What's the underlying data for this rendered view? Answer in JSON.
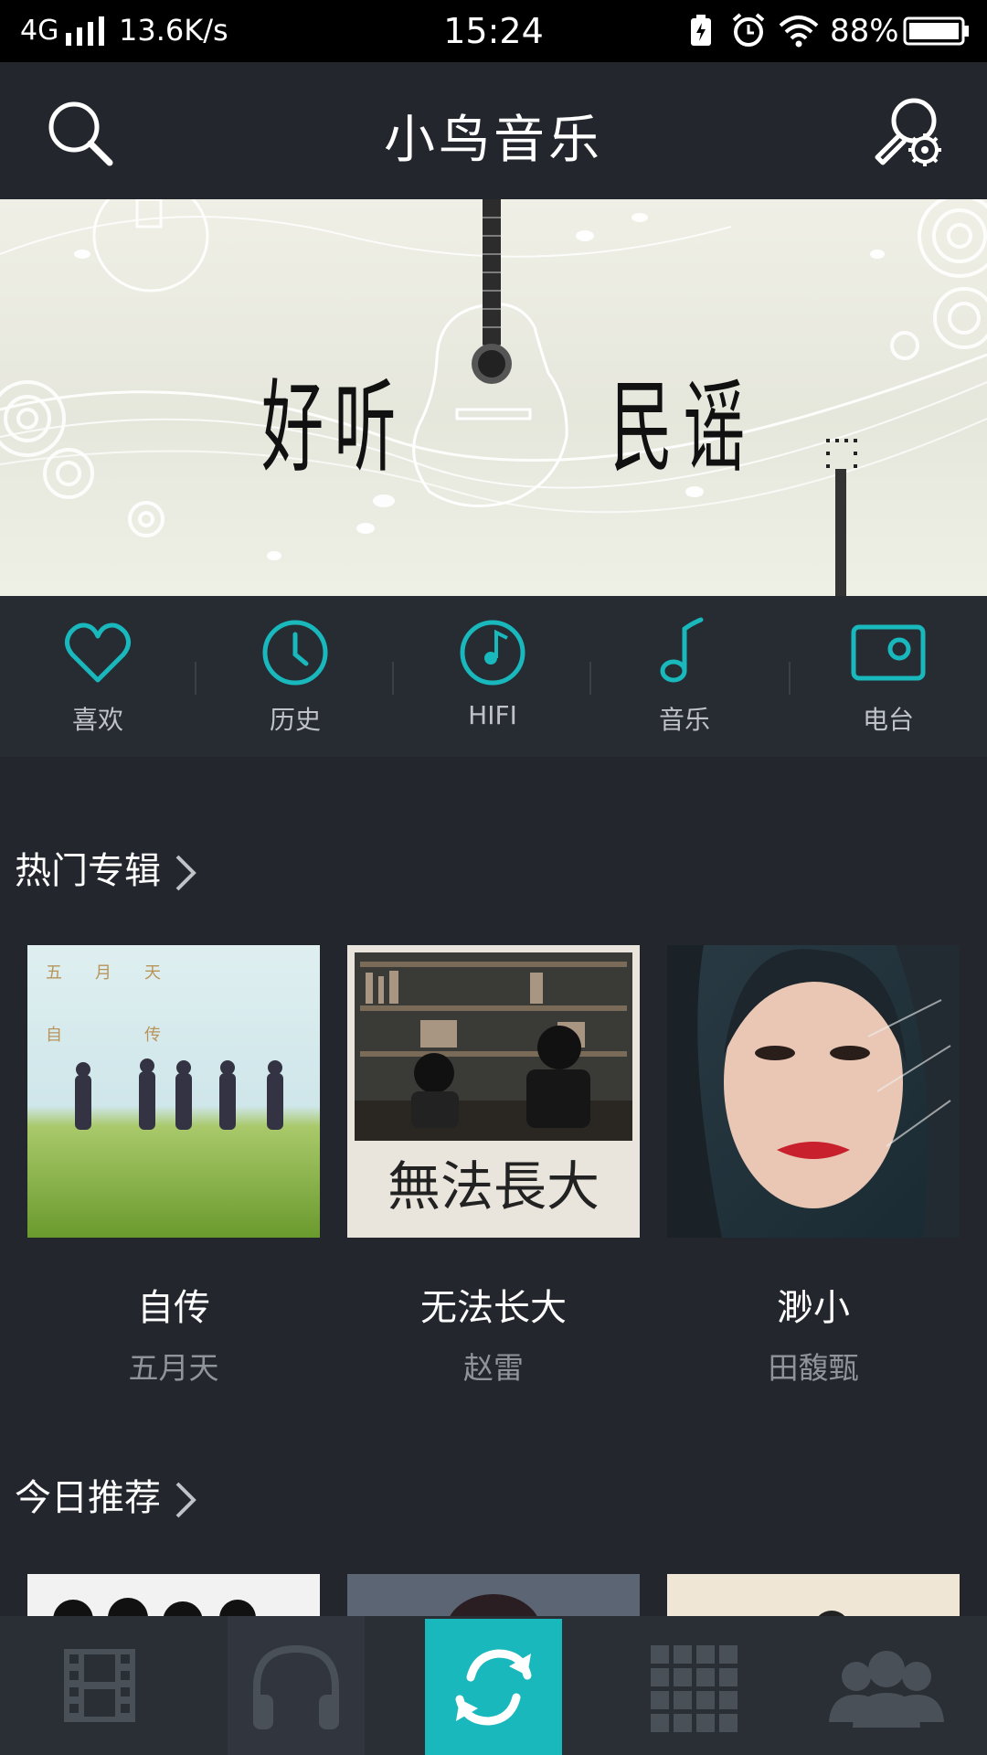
{
  "status_bar": {
    "network": "4G",
    "speed": "13.6K/s",
    "time": "15:24",
    "battery_percent": "88%"
  },
  "header": {
    "title": "小鸟音乐"
  },
  "banner": {
    "left_text": "好听",
    "right_text": "民谣"
  },
  "quick_nav": [
    {
      "label": "喜欢",
      "icon": "heart-icon"
    },
    {
      "label": "历史",
      "icon": "clock-icon"
    },
    {
      "label": "HIFI",
      "icon": "hifi-disc-icon"
    },
    {
      "label": "音乐",
      "icon": "music-note-icon"
    },
    {
      "label": "电台",
      "icon": "radio-icon"
    }
  ],
  "hot_albums": {
    "title": "热门专辑",
    "items": [
      {
        "name": "自传",
        "artist": "五月天"
      },
      {
        "name": "无法长大",
        "artist": "赵雷"
      },
      {
        "name": "渺小",
        "artist": "田馥甄"
      }
    ]
  },
  "cover_text": {
    "album1_top": "五　　月　　天",
    "album1_sub": "自　　　　　传",
    "album2_title": "無法長大"
  },
  "today_recommend": {
    "title": "今日推荐"
  },
  "bottom_nav": [
    {
      "icon": "film-icon"
    },
    {
      "icon": "headphones-icon"
    },
    {
      "icon": "refresh-icon"
    },
    {
      "icon": "grid-icon"
    },
    {
      "icon": "people-icon"
    }
  ],
  "colors": {
    "accent": "#19b8bd",
    "background": "#23272d",
    "status_bar": "#000000"
  }
}
